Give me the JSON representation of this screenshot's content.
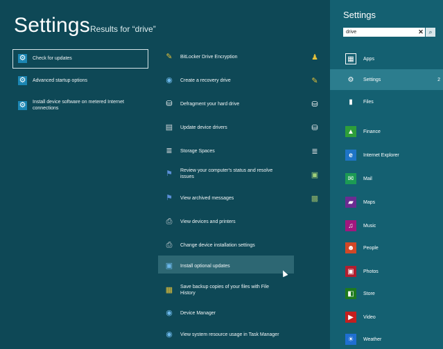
{
  "header": {
    "title": "Settings",
    "subtitle": "Results for “drive”"
  },
  "column1": [
    {
      "label": "Check for updates"
    },
    {
      "label": "Advanced startup options"
    },
    {
      "label": "Install device software on metered Internet connections"
    }
  ],
  "column2": [
    {
      "label": "BitLocker Drive Encryption"
    },
    {
      "label": "Create a recovery drive"
    },
    {
      "label": "Defragment your hard drive"
    },
    {
      "label": "Update device drivers"
    },
    {
      "label": "Storage Spaces"
    },
    {
      "label": "Review your computer's status and resolve issues"
    },
    {
      "label": "View archived messages"
    },
    {
      "label": "View devices and printers"
    },
    {
      "label": "Change device installation settings"
    },
    {
      "label": "Install optional updates"
    },
    {
      "label": "Save backup copies of your files with File History"
    },
    {
      "label": "Device Manager"
    },
    {
      "label": "View system resource usage in Task Manager"
    }
  ],
  "charm": {
    "title": "Settings",
    "query": "drive",
    "categories": [
      {
        "label": "Apps",
        "count": ""
      },
      {
        "label": "Settings",
        "count": "2"
      },
      {
        "label": "Files",
        "count": ""
      }
    ],
    "apps": [
      {
        "label": "Finance",
        "color": "#2e9e3a",
        "icon": "chart-icon"
      },
      {
        "label": "Internet Explorer",
        "color": "#1e74c6",
        "icon": "ie-icon"
      },
      {
        "label": "Mail",
        "color": "#1c9a54",
        "icon": "mail-icon"
      },
      {
        "label": "Maps",
        "color": "#6b2c91",
        "icon": "map-icon"
      },
      {
        "label": "Music",
        "color": "#a1177e",
        "icon": "headphones-icon"
      },
      {
        "label": "People",
        "color": "#d24726",
        "icon": "people-icon"
      },
      {
        "label": "Photos",
        "color": "#b01e2f",
        "icon": "photo-icon"
      },
      {
        "label": "Store",
        "color": "#1e7a1e",
        "icon": "store-icon"
      },
      {
        "label": "Video",
        "color": "#c41e1e",
        "icon": "video-icon"
      },
      {
        "label": "Weather",
        "color": "#1f6fd1",
        "icon": "weather-icon"
      }
    ]
  }
}
